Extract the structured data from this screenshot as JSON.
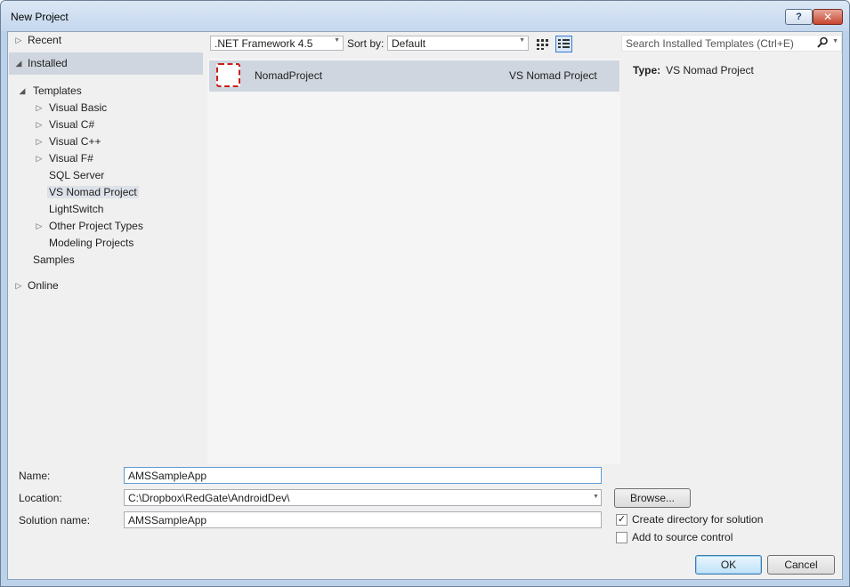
{
  "window": {
    "title": "New Project",
    "help_label": "?",
    "close_label": "✕"
  },
  "nav": {
    "recent": "Recent",
    "installed": "Installed",
    "templates": "Templates",
    "visual_basic": "Visual Basic",
    "visual_csharp": "Visual C#",
    "visual_cpp": "Visual C++",
    "visual_fsharp": "Visual F#",
    "sql_server": "SQL Server",
    "vs_nomad_project": "VS Nomad Project",
    "lightswitch": "LightSwitch",
    "other_project_types": "Other Project Types",
    "modeling_projects": "Modeling Projects",
    "samples": "Samples",
    "online": "Online",
    "collapsed_arrow": "▷",
    "expanded_arrow": "◢",
    "selected_item": "VS Nomad Project"
  },
  "toolbar": {
    "framework": ".NET Framework 4.5",
    "sort_by_label": "Sort by:",
    "sort_value": "Default",
    "search_placeholder": "Search Installed Templates (Ctrl+E)",
    "search_icon": "search-icon",
    "dropdown_glyph": "▼"
  },
  "templates": [
    {
      "name": "NomadProject",
      "type": "VS Nomad Project",
      "icon": "nomad-project-icon"
    }
  ],
  "details": {
    "type_label": "Type:",
    "type_value": "VS Nomad Project"
  },
  "form": {
    "name_label": "Name:",
    "name_value": "AMSSampleApp",
    "location_label": "Location:",
    "location_value": "C:\\Dropbox\\RedGate\\AndroidDev\\",
    "solution_name_label": "Solution name:",
    "solution_name_value": "AMSSampleApp",
    "browse_label": "Browse...",
    "create_directory_label": "Create directory for solution",
    "create_directory_checked": true,
    "add_source_control_label": "Add to source control",
    "add_source_control_checked": false,
    "check_glyph": "✓"
  },
  "buttons": {
    "ok": "OK",
    "cancel": "Cancel"
  },
  "colors": {
    "selection": "#cfd6df",
    "dialog_bg": "#f0f0f0",
    "accent": "#3c7fb1"
  }
}
